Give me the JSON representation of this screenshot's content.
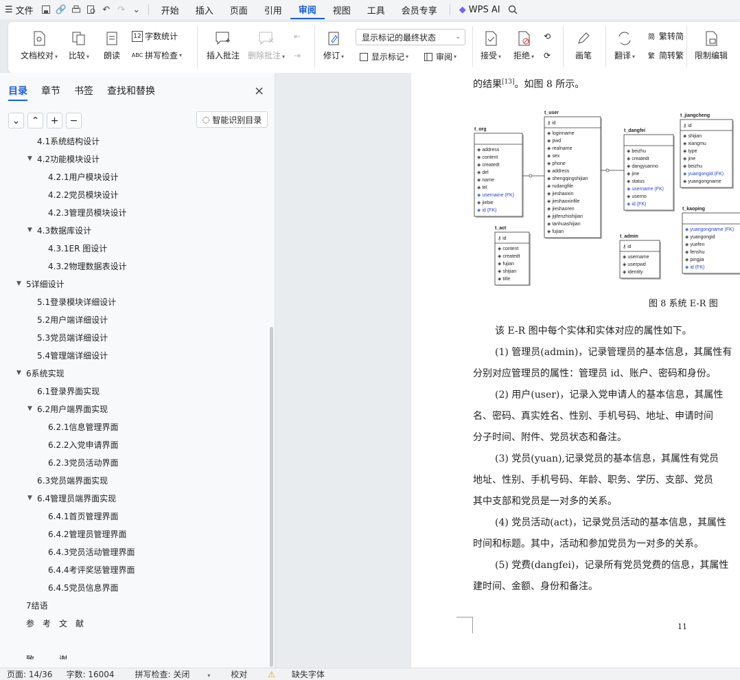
{
  "menu": {
    "file": "文件",
    "tabs": [
      "开始",
      "插入",
      "页面",
      "引用",
      "审阅",
      "视图",
      "工具",
      "会员专享"
    ],
    "active_tab": "审阅",
    "wps_ai": "WPS AI"
  },
  "ribbon": {
    "doc_check": "文档校对",
    "compare": "比较",
    "read_aloud": "朗读",
    "word_count": "字数统计",
    "spell_check": "拼写检查",
    "insert_comment": "插入批注",
    "delete_comment": "删除批注",
    "markup_dropdown": "显示标记的最终状态",
    "track_changes": "修订",
    "show_markup": "显示标记",
    "review": "审阅",
    "accept": "接受",
    "reject": "拒绝",
    "brush": "画笔",
    "translate": "翻译",
    "trad": "繁转简",
    "simp": "简转繁",
    "restrict": "限制编辑"
  },
  "nav": {
    "tabs": [
      "目录",
      "章节",
      "书签",
      "查找和替换"
    ],
    "active": "目录",
    "smart_toc": "智能识别目录",
    "toc": [
      {
        "level": 2,
        "text": "4.1系统结构设计",
        "arrow": false
      },
      {
        "level": 2,
        "text": "4.2功能模块设计",
        "arrow": true
      },
      {
        "level": 3,
        "text": "4.2.1用户模块设计",
        "arrow": false
      },
      {
        "level": 3,
        "text": "4.2.2党员模块设计",
        "arrow": false
      },
      {
        "level": 3,
        "text": "4.2.3管理员模块设计",
        "arrow": false
      },
      {
        "level": 2,
        "text": "4.3数据库设计",
        "arrow": true
      },
      {
        "level": 3,
        "text": "4.3.1ER 图设计",
        "arrow": false
      },
      {
        "level": 3,
        "text": "4.3.2物理数据表设计",
        "arrow": false
      },
      {
        "level": 1,
        "text": "5详细设计",
        "arrow": true
      },
      {
        "level": 2,
        "text": "5.1登录模块详细设计",
        "arrow": false
      },
      {
        "level": 2,
        "text": "5.2用户端详细设计",
        "arrow": false
      },
      {
        "level": 2,
        "text": "5.3党员端详细设计",
        "arrow": false
      },
      {
        "level": 2,
        "text": "5.4管理端详细设计",
        "arrow": false
      },
      {
        "level": 1,
        "text": "6系统实现",
        "arrow": true
      },
      {
        "level": 2,
        "text": "6.1登录界面实现",
        "arrow": false
      },
      {
        "level": 2,
        "text": "6.2用户端界面实现",
        "arrow": true
      },
      {
        "level": 3,
        "text": "6.2.1信息管理界面",
        "arrow": false
      },
      {
        "level": 3,
        "text": "6.2.2入党申请界面",
        "arrow": false
      },
      {
        "level": 3,
        "text": "6.2.3党员活动界面",
        "arrow": false
      },
      {
        "level": 2,
        "text": "6.3党员端界面实现",
        "arrow": false
      },
      {
        "level": 2,
        "text": "6.4管理员端界面实现",
        "arrow": true
      },
      {
        "level": 3,
        "text": "6.4.1首页管理界面",
        "arrow": false
      },
      {
        "level": 3,
        "text": "6.4.2管理员管理界面",
        "arrow": false
      },
      {
        "level": 3,
        "text": "6.4.3党员活动管理界面",
        "arrow": false
      },
      {
        "level": 3,
        "text": "6.4.4考评奖惩管理界面",
        "arrow": false
      },
      {
        "level": 3,
        "text": "6.4.5党员信息界面",
        "arrow": false
      },
      {
        "level": 1,
        "text": "7结语",
        "arrow": false
      },
      {
        "level": 1,
        "text": "参　考　文　献",
        "arrow": false
      },
      {
        "level": 1,
        "text": "",
        "arrow": false
      },
      {
        "level": 1,
        "text": "致　　　谢",
        "arrow": false
      }
    ]
  },
  "doc": {
    "lines": [
      "的结果[13]。如图 8 所示。",
      "该 E-R 图中每个实体和实体对应的属性如下。",
      "(1) 管理员(admin)，记录管理员的基本信息，其属性有",
      "分别对应管理员的属性：管理员 id、账户、密码和身份。",
      "(2) 用户(user)，记录入党申请人的基本信息，其属性",
      "名、密码、真实姓名、性别、手机号码、地址、申请时间",
      "分子时间、附件、党员状态和备注。",
      "(3) 党员(yuan),记录党员的基本信息，其属性有党员",
      "地址、性别、手机号码、年龄、职务、学历、支部、党员",
      "其中支部和党员是一对多的关系。",
      "(4) 党员活动(act)，记录党员活动的基本信息，其属性",
      "时间和标题。其中，活动和参加党员为一对多的关系。",
      "(5) 党费(dangfei)，记录所有党员党费的信息，其属性",
      "建时间、金额、身份和备注。"
    ],
    "figure_caption": "图 8 系统 E-R 图",
    "page_number": "11",
    "er": {
      "t_org": [
        "address",
        "content",
        "createdt",
        "del",
        "name",
        "tel",
        "username (FK)",
        "jiebie",
        "id (FK)"
      ],
      "t_user": [
        "loginname",
        "pwd",
        "realname",
        "sex",
        "phone",
        "address",
        "shengqingshijian",
        "rudangfile",
        "jieshaoxin",
        "jieshaoxinfile",
        "jieshaoren",
        "jijifenzhishijian",
        "tanhuashijian",
        "fujian"
      ],
      "t_dangfei": [
        "beizhu",
        "createdt",
        "dangyuanno",
        "jine",
        "status",
        "username (FK)",
        "userno",
        "id (FK)"
      ],
      "t_jiangcheng": [
        "shijian",
        "xiangmu",
        "type",
        "jine",
        "beizhu",
        "yuangongid (FK)",
        "yuangongname"
      ],
      "t_act": [
        "content",
        "createdt",
        "fujian",
        "shijian",
        "title"
      ],
      "t_admin": [
        "username",
        "userpwd",
        "identity"
      ],
      "t_kaoping": [
        "yuangongname (FK)",
        "yuangongid",
        "yuefen",
        "fenshu",
        "pingjia",
        "id (FK)"
      ]
    }
  },
  "status": {
    "page": "页面: 14/36",
    "words": "字数: 16004",
    "spell": "拼写检查: 关闭",
    "proof": "校对",
    "font": "缺失字体"
  }
}
